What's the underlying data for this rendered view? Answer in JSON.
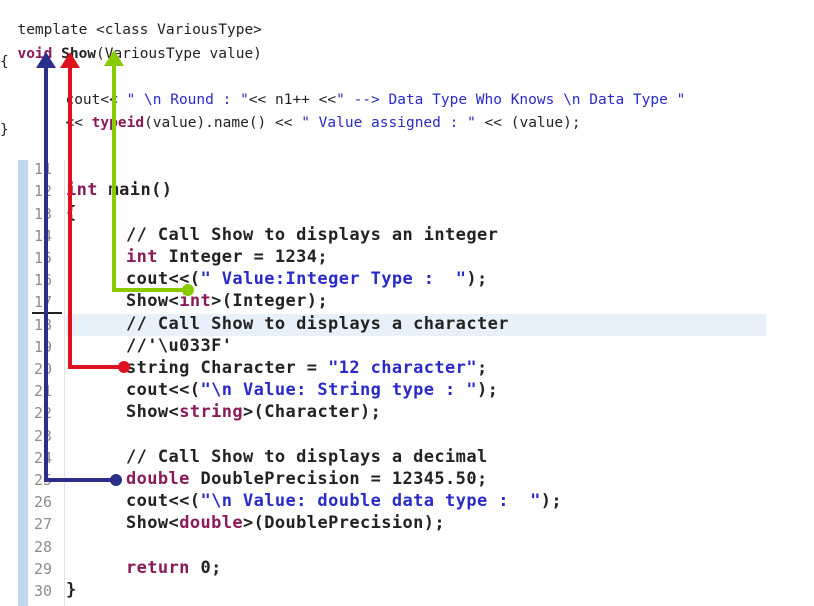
{
  "top_code": {
    "line1": "template <class VariousType>",
    "line2_kw": "void",
    "line2_func": " Show",
    "line2_rest": "(VariousType value)",
    "line3": "{",
    "line4_a": "cout<< ",
    "line4_b": "\" \\n Round : \"",
    "line4_c": "<< n1++ <<",
    "line4_d": "\" --> Data Type Who Knows \\n Data Type \"",
    "line5_a": "<< ",
    "line5_b": "typeid",
    "line5_c": "(value).name() << ",
    "line5_d": "\" Value assigned : \"",
    "line5_e": " << (value);",
    "line6": "}"
  },
  "line_numbers": [
    "11",
    "12",
    "13",
    "14",
    "15",
    "16",
    "17",
    "18",
    "19",
    "20",
    "21",
    "22",
    "23",
    "24",
    "25",
    "26",
    "27",
    "28",
    "29",
    "30"
  ],
  "main_code": {
    "l12_kw": "int",
    "l12_rest": " main()",
    "l13": "{",
    "l14": "// Call Show to displays an integer",
    "l15_kw": "int",
    "l15_rest": " Integer = 1234;",
    "l16_a": "cout<<(",
    "l16_b": "\" Value:Integer Type :  \"",
    "l16_c": ");",
    "l17_a": "Show<",
    "l17_b": "int",
    "l17_c": ">(Integer);",
    "l18": "// Call Show to displays a character",
    "l19": "//'\\u033F'",
    "l20_a": "string Character = ",
    "l20_b": "\"12 character\"",
    "l20_c": ";",
    "l21_a": "cout<<(",
    "l21_b": "\"\\n Value: String type : \"",
    "l21_c": ");",
    "l22_a": "Show<",
    "l22_b": "string",
    "l22_c": ">(Character);",
    "l24": "// Call Show to displays a decimal",
    "l25_kw": "double",
    "l25_rest": " DoublePrecision = 12345.50;",
    "l26_a": "cout<<(",
    "l26_b": "\"\\n Value: double data type :  \"",
    "l26_c": ");",
    "l27_a": "Show<",
    "l27_b": "double",
    "l27_c": ">(DoublePrecision);",
    "l29_kw": "return",
    "l29_rest": " 0;",
    "l30": "}"
  },
  "arrows": [
    {
      "name": "green",
      "color": "#88cc00"
    },
    {
      "name": "red",
      "color": "#e0101e"
    },
    {
      "name": "navy",
      "color": "#2a2f8a"
    }
  ]
}
